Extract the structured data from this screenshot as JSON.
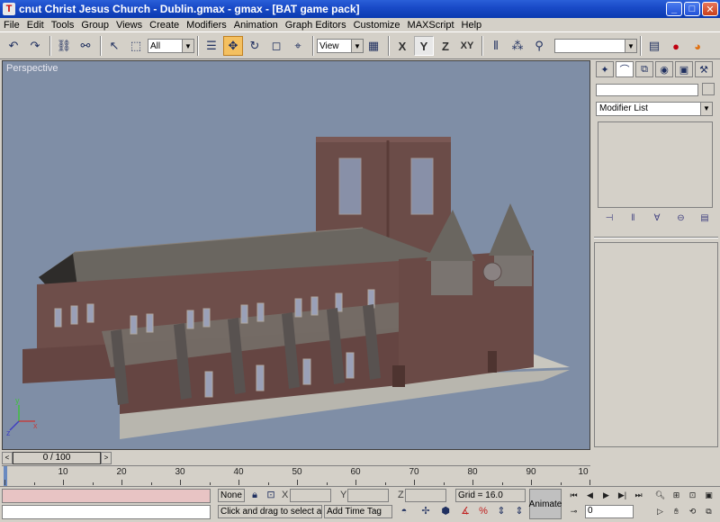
{
  "window": {
    "title": "cnut Christ Jesus Church - Dublin.gmax - gmax - [BAT game pack]",
    "minimize": "_",
    "maximize": "□",
    "close": "✕",
    "app_icon": "T"
  },
  "menu": [
    "File",
    "Edit",
    "Tools",
    "Group",
    "Views",
    "Create",
    "Modifiers",
    "Animation",
    "Graph Editors",
    "Customize",
    "MAXScript",
    "Help"
  ],
  "toolbar": {
    "selection_filter": "All",
    "reference_coord": "View",
    "axis_x": "X",
    "axis_y": "Y",
    "axis_z": "Z",
    "axis_xy": "XY",
    "named_selection": ""
  },
  "viewport": {
    "label": "Perspective",
    "axis_x": "x",
    "axis_y": "y",
    "axis_z": "z"
  },
  "command_panel": {
    "modifier_list": "Modifier List",
    "object_name": ""
  },
  "timeline": {
    "frame_display": "0 / 100",
    "ticks": [
      "10",
      "20",
      "30",
      "40",
      "50",
      "60",
      "70",
      "80",
      "90",
      "10"
    ]
  },
  "status": {
    "selection": "None S",
    "x_label": "X",
    "y_label": "Y",
    "z_label": "Z",
    "grid": "Grid = 16.0",
    "prompt": "Click and drag to select and m",
    "add_time_tag": "Add Time Tag",
    "animate": "Animate",
    "current_frame": "0"
  },
  "colors": {
    "viewport_bg": "#7f8ea6",
    "title_bar": "#0a3ab0",
    "brick": "#6e4e4a",
    "roof": "#6a6660"
  }
}
